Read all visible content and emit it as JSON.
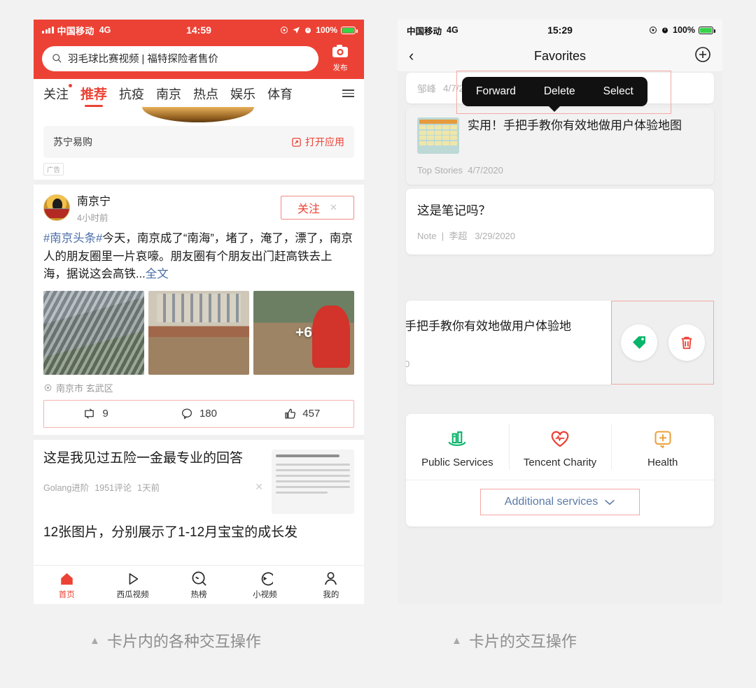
{
  "background": "#f2f2f2",
  "accent_red": "#ec4235",
  "highlight_border": "#f3a9a6",
  "left_phone": {
    "status": {
      "carrier": "中国移动",
      "network": "4G",
      "time": "14:59",
      "battery": "100%"
    },
    "search": {
      "query": "羽毛球比赛视频 | 福特探险者售价",
      "icon": "search-icon"
    },
    "camera": {
      "icon": "camera-icon",
      "label": "发布"
    },
    "tabs": [
      {
        "label": "关注",
        "active": false,
        "dot": true
      },
      {
        "label": "推荐",
        "active": true,
        "dot": false
      },
      {
        "label": "抗疫",
        "active": false,
        "dot": false
      },
      {
        "label": "南京",
        "active": false,
        "dot": false
      },
      {
        "label": "热点",
        "active": false,
        "dot": false
      },
      {
        "label": "娱乐",
        "active": false,
        "dot": false
      },
      {
        "label": "体育",
        "active": false,
        "dot": false
      }
    ],
    "menu_icon": "hamburger-icon",
    "ad": {
      "brand": "苏宁易购",
      "open_label": "打开应用",
      "open_icon": "external-link-icon",
      "tag": "广告"
    },
    "post": {
      "author": "南京宁",
      "time": "4小时前",
      "follow_label": "关注",
      "close_label": "✕",
      "hashtag": "#南京头条#",
      "text": "今天，南京成了“南海”，堵了，淹了，漂了，南京人的朋友圈里一片哀嚎。朋友圈有个朋友出门赶高铁去上海，据说这会高铁...",
      "more_label": "全文",
      "extra_photos": "+6",
      "location": "南京市 玄武区",
      "location_icon": "location-pin-icon",
      "actions": [
        {
          "icon": "repost-icon",
          "count": "9"
        },
        {
          "icon": "comment-icon",
          "count": "180"
        },
        {
          "icon": "thumbs-up-icon",
          "count": "457"
        }
      ]
    },
    "article1": {
      "title": "这是我见过五险一金最专业的回答",
      "source": "Golang进阶",
      "comments": "1951评论",
      "time": "1天前",
      "close_icon": "close-icon"
    },
    "article2": {
      "title": "12张图片，分别展示了1-12月宝宝的成长发"
    },
    "tabbar": [
      {
        "label": "首页",
        "icon": "home-icon",
        "active": true
      },
      {
        "label": "西瓜视频",
        "icon": "play-triangle-icon",
        "active": false
      },
      {
        "label": "热榜",
        "icon": "trending-circle-icon",
        "active": false
      },
      {
        "label": "小视频",
        "icon": "short-video-icon",
        "active": false
      },
      {
        "label": "我的",
        "icon": "person-icon",
        "active": false
      }
    ]
  },
  "right_phone": {
    "status": {
      "carrier": "中国移动",
      "network": "4G",
      "time": "15:29",
      "battery": "100%"
    },
    "nav": {
      "back_icon": "chevron-left-icon",
      "title": "Favorites",
      "add_icon": "plus-circle-icon"
    },
    "hidden_row": {
      "author": "邹峰",
      "date": "4/7/2"
    },
    "popup": {
      "items": [
        "Forward",
        "Delete",
        "Select"
      ]
    },
    "fav_item": {
      "title": "实用！手把手教你有效地做用户体验地图",
      "source": "Top Stories",
      "date": "4/7/2020",
      "thumb_icon": "article-thumbnail"
    },
    "note_item": {
      "title": "这是笔记吗？",
      "kind": "Note",
      "author": "李超",
      "date": "3/29/2020",
      "separator": "|"
    },
    "swipe_card": {
      "title": "手把手教你有效地做用户体验地",
      "meta": "0",
      "actions": [
        {
          "icon": "tag-icon",
          "color": "#09b56a"
        },
        {
          "icon": "trash-icon",
          "color": "#ec4235"
        }
      ]
    },
    "services": {
      "items": [
        {
          "label": "Public Services",
          "icon": "government-building-icon",
          "color": "#09b56a"
        },
        {
          "label": "Tencent Charity",
          "icon": "heart-pulse-icon",
          "color": "#ec4235"
        },
        {
          "label": "Health",
          "icon": "health-plus-icon",
          "color": "#eba23c"
        }
      ],
      "more_label": "Additional services",
      "more_icon": "chevron-down-icon"
    }
  },
  "captions": {
    "left": "卡片内的各种交互操作",
    "right": "卡片的交互操作",
    "marker": "▲"
  }
}
